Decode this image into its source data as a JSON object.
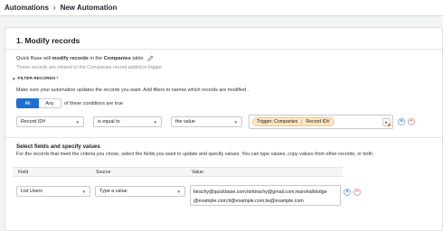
{
  "breadcrumb": {
    "root": "Automations",
    "separator": "›",
    "current": "New Automation"
  },
  "section": {
    "title": "1. Modify records",
    "desc": {
      "prefix": "Quick Base will",
      "action": "modify records",
      "middle": "in the",
      "table": "Companies",
      "suffix": "table"
    },
    "subdesc": "These records are related to the Companies record added in trigger"
  },
  "filter": {
    "header": "FILTER RECORDS *",
    "hint": "Make sure your automation updates the records you want. Add filters to narrow which records are modified .",
    "toggle": {
      "all": "All",
      "any": "Any",
      "tail": "of these conditions are true"
    },
    "row": {
      "field": "Record ID#",
      "operator": "is equal to",
      "value_type": "the value",
      "trigger_chip": "Trigger: Companies",
      "trigger_field": "Record ID#"
    }
  },
  "fields": {
    "title": "Select fields and specify values",
    "desc": "For the records that meet the criteria you chose, select the fields you want to update and specify values. You can type values, copy values from other records, or both.",
    "columns": {
      "field": "Field",
      "source": "Source",
      "value": "Value"
    },
    "row": {
      "field": "List Users",
      "source": "Type a value",
      "value_line1": "ktrachy@quickbase.com;kirktrachy@gmail.com;marshalldodge",
      "value_line2": "@example.com;tt@example.com;tw@example.com"
    }
  },
  "icons": {
    "edit": "pencil-icon",
    "insert": "insert-field-icon",
    "add": "plus-icon",
    "remove": "minus-icon",
    "dropdown": "chevron-down-icon",
    "collapse": "caret-down-icon"
  },
  "colors": {
    "primary": "#1f6fd1",
    "chip_bg": "#fde6c4",
    "danger": "#d63c3c"
  }
}
